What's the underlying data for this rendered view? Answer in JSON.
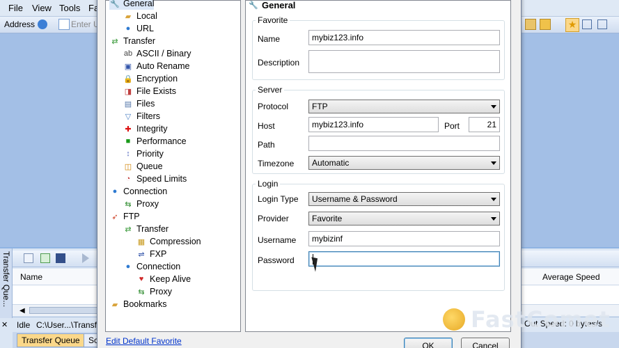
{
  "menubar": {
    "items": [
      "File",
      "View",
      "Tools",
      "Fa"
    ]
  },
  "addressbar": {
    "label": "Address",
    "placeholder": "Enter U"
  },
  "queue": {
    "side_tab": "Transfer Que...",
    "column_name": "Name",
    "column_avg_speed": "Average Speed",
    "status_idle": "Idle",
    "status_path": "C:\\User...\\Transf",
    "status_out_speed": "Out Speed: 0 bytes/s",
    "tabs": [
      "Transfer Queue",
      "Sc"
    ]
  },
  "tree": {
    "items": [
      {
        "label": "General",
        "icon": "wrench-icon",
        "level": 0
      },
      {
        "label": "Local",
        "icon": "folder-icon",
        "level": 1
      },
      {
        "label": "URL",
        "icon": "globe-icon",
        "level": 1
      },
      {
        "label": "Transfer",
        "icon": "transfer-icon",
        "level": 0
      },
      {
        "label": "ASCII / Binary",
        "icon": "ab-icon",
        "level": 1
      },
      {
        "label": "Auto Rename",
        "icon": "rename-icon",
        "level": 1
      },
      {
        "label": "Encryption",
        "icon": "lock-icon",
        "level": 1
      },
      {
        "label": "File Exists",
        "icon": "file-exists-icon",
        "level": 1
      },
      {
        "label": "Files",
        "icon": "files-icon",
        "level": 1
      },
      {
        "label": "Filters",
        "icon": "filter-icon",
        "level": 1
      },
      {
        "label": "Integrity",
        "icon": "cross-icon",
        "level": 1
      },
      {
        "label": "Performance",
        "icon": "performance-icon",
        "level": 1
      },
      {
        "label": "Priority",
        "icon": "priority-icon",
        "level": 1
      },
      {
        "label": "Queue",
        "icon": "queue-icon",
        "level": 1
      },
      {
        "label": "Speed Limits",
        "icon": "speed-icon",
        "level": 1
      },
      {
        "label": "Connection",
        "icon": "globe-icon",
        "level": 0
      },
      {
        "label": "Proxy",
        "icon": "proxy-icon",
        "level": 1
      },
      {
        "label": "FTP",
        "icon": "ftp-icon",
        "level": 0
      },
      {
        "label": "Transfer",
        "icon": "transfer-icon",
        "level": 1
      },
      {
        "label": "Compression",
        "icon": "compression-icon",
        "level": 2
      },
      {
        "label": "FXP",
        "icon": "fxp-icon",
        "level": 2
      },
      {
        "label": "Connection",
        "icon": "globe-icon",
        "level": 1
      },
      {
        "label": "Keep Alive",
        "icon": "heart-icon",
        "level": 2
      },
      {
        "label": "Proxy",
        "icon": "proxy-icon",
        "level": 2
      },
      {
        "label": "Bookmarks",
        "icon": "folder-icon",
        "level": 0
      }
    ]
  },
  "panel": {
    "header": "General",
    "favorite": {
      "title": "Favorite",
      "name_label": "Name",
      "name_value": "mybiz123.info",
      "description_label": "Description",
      "description_value": ""
    },
    "server": {
      "title": "Server",
      "protocol_label": "Protocol",
      "protocol_value": "FTP",
      "host_label": "Host",
      "host_value": "mybiz123.info",
      "port_label": "Port",
      "port_value": "21",
      "path_label": "Path",
      "path_value": "",
      "timezone_label": "Timezone",
      "timezone_value": "Automatic"
    },
    "login": {
      "title": "Login",
      "login_type_label": "Login Type",
      "login_type_value": "Username & Password",
      "provider_label": "Provider",
      "provider_value": "Favorite",
      "username_label": "Username",
      "username_value": "mybizinf",
      "password_label": "Password",
      "password_value": ""
    }
  },
  "footer": {
    "edit_default_link": "Edit Default Favorite",
    "ok_label": "OK",
    "cancel_label": "Cancel"
  },
  "watermark": {
    "text": "FastComet"
  }
}
